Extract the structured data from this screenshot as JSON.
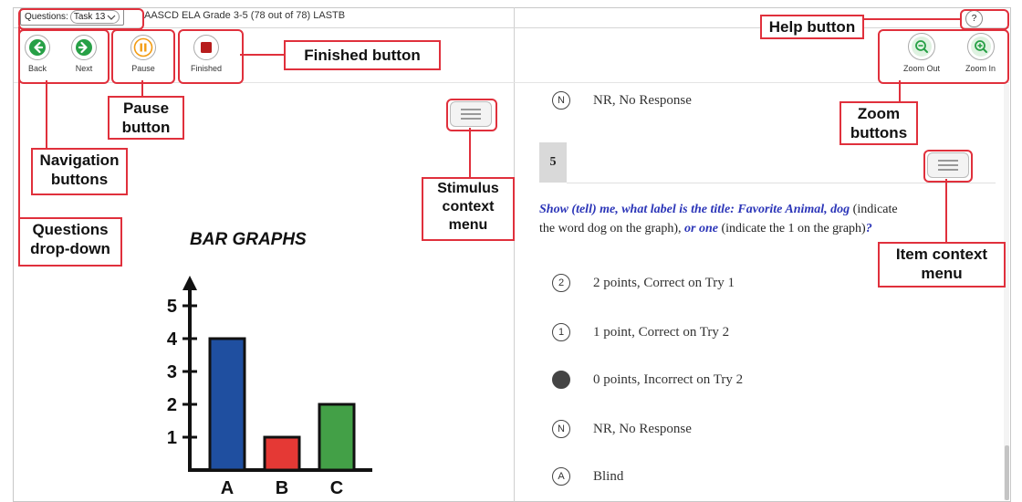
{
  "top_bar": {
    "questions_label": "Questions:",
    "questions_value": "Task 13",
    "test_title": "AASCD ELA Grade 3-5 (78 out of 78) LASTB",
    "help_glyph": "?"
  },
  "toolbar": {
    "back_label": "Back",
    "next_label": "Next",
    "pause_label": "Pause",
    "finished_label": "Finished",
    "zoom_out_label": "Zoom Out",
    "zoom_in_label": "Zoom In"
  },
  "callouts": {
    "help": "Help button",
    "finished": "Finished button",
    "pause": "Pause button",
    "navigation": "Navigation buttons",
    "questions_dropdown": "Questions drop-down",
    "stimulus_menu": "Stimulus context menu",
    "zoom": "Zoom buttons",
    "item_menu": "Item context menu"
  },
  "stimulus": {
    "title": "BAR GRAPHS"
  },
  "chart_data": {
    "type": "bar",
    "title": "BAR GRAPHS",
    "categories": [
      "A",
      "B",
      "C"
    ],
    "values": [
      4,
      1,
      2
    ],
    "colors": [
      "#1f4fa0",
      "#e53935",
      "#43a047"
    ],
    "y_ticks": [
      "1",
      "2",
      "3",
      "4",
      "5"
    ],
    "ylim": [
      0,
      5
    ],
    "grid": false
  },
  "item": {
    "number": "5",
    "prompt": {
      "p1": "Show (tell) me, what label is the title: Favorite Animal,",
      "p2": "dog",
      "p3": " (indicate the word dog on the graph), ",
      "p4": "or one",
      "p5": " (indicate the 1 on the graph)",
      "p6": "?"
    },
    "top_option": {
      "glyph": "N",
      "text": "NR, No Response"
    },
    "options": [
      {
        "glyph": "2",
        "text": "2 points, Correct on Try 1",
        "selected": false
      },
      {
        "glyph": "1",
        "text": "1 point, Correct on Try 2",
        "selected": false
      },
      {
        "glyph": "",
        "text": "0 points, Incorrect on Try 2",
        "selected": true
      },
      {
        "glyph": "N",
        "text": "NR, No Response",
        "selected": false
      },
      {
        "glyph": "A",
        "text": "Blind",
        "selected": false
      }
    ]
  },
  "colors": {
    "accent_green": "#27a046",
    "pause_orange": "#f39c12",
    "finished_red": "#b71c1c",
    "callout_red": "#e0303c",
    "prompt_blue": "#2b35b8"
  },
  "icons": {
    "back": "arrow-left-icon",
    "next": "arrow-right-icon",
    "pause": "pause-icon",
    "finished": "stop-icon",
    "zoom_out": "magnifier-minus-icon",
    "zoom_in": "magnifier-plus-icon",
    "help": "question-mark-icon",
    "menu": "hamburger-menu-icon"
  }
}
